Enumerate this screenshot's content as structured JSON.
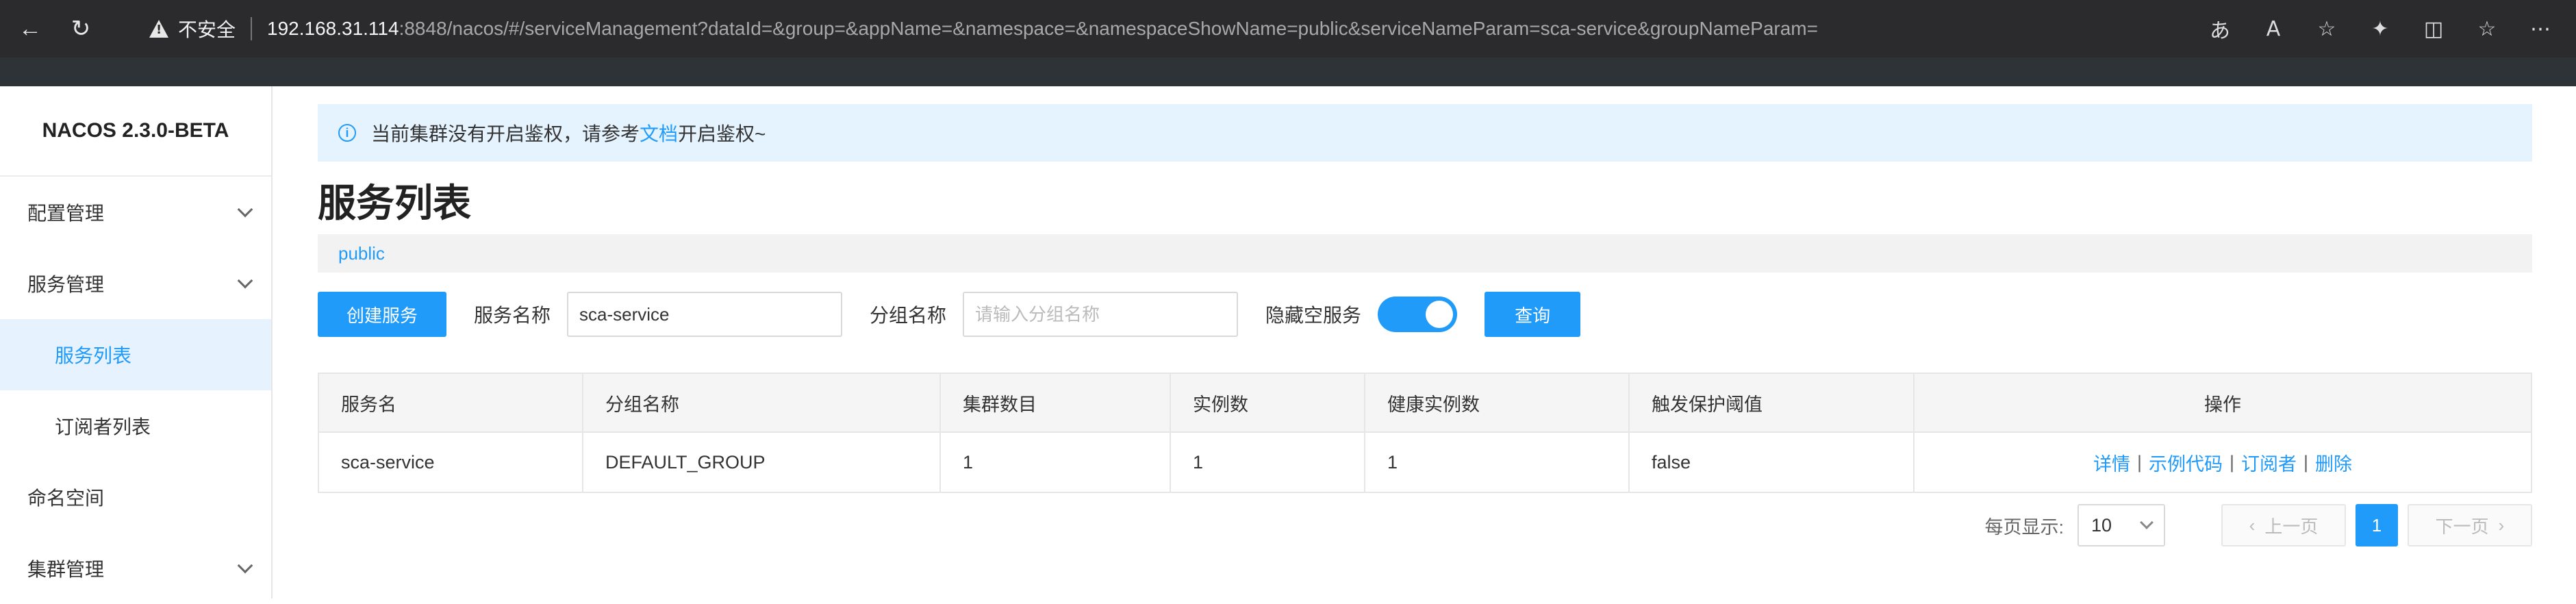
{
  "browser": {
    "security_label": "不安全",
    "url_host": "192.168.31.114",
    "url_rest": ":8848/nacos/#/serviceManagement?dataId=&group=&appName=&namespace=&namespaceShowName=public&serviceNameParam=sca-service&groupNameParam="
  },
  "sidebar": {
    "brand": "NACOS 2.3.0-BETA",
    "items": [
      {
        "label": "配置管理"
      },
      {
        "label": "服务管理"
      },
      {
        "label": "服务列表"
      },
      {
        "label": "订阅者列表"
      },
      {
        "label": "命名空间"
      },
      {
        "label": "集群管理"
      }
    ]
  },
  "notice": {
    "text_before": "当前集群没有开启鉴权，请参考",
    "link": "文档",
    "text_after": "开启鉴权~"
  },
  "page": {
    "title": "服务列表",
    "namespace": "public"
  },
  "toolbar": {
    "create_button": "创建服务",
    "service_name_label": "服务名称",
    "service_name_value": "sca-service",
    "group_name_label": "分组名称",
    "group_name_placeholder": "请输入分组名称",
    "hide_empty_label": "隐藏空服务",
    "query_button": "查询"
  },
  "table": {
    "headers": [
      "服务名",
      "分组名称",
      "集群数目",
      "实例数",
      "健康实例数",
      "触发保护阈值",
      "操作"
    ],
    "rows": [
      {
        "service": "sca-service",
        "group": "DEFAULT_GROUP",
        "clusters": "1",
        "instances": "1",
        "healthy": "1",
        "threshold": "false",
        "ops": [
          "详情",
          "示例代码",
          "订阅者",
          "删除"
        ]
      }
    ]
  },
  "pagination": {
    "per_page_label": "每页显示:",
    "per_page_value": "10",
    "prev": "上一页",
    "current": "1",
    "next": "下一页"
  },
  "colors": {
    "accent": "#209bfa",
    "notice_bg": "#e5f3ff"
  }
}
